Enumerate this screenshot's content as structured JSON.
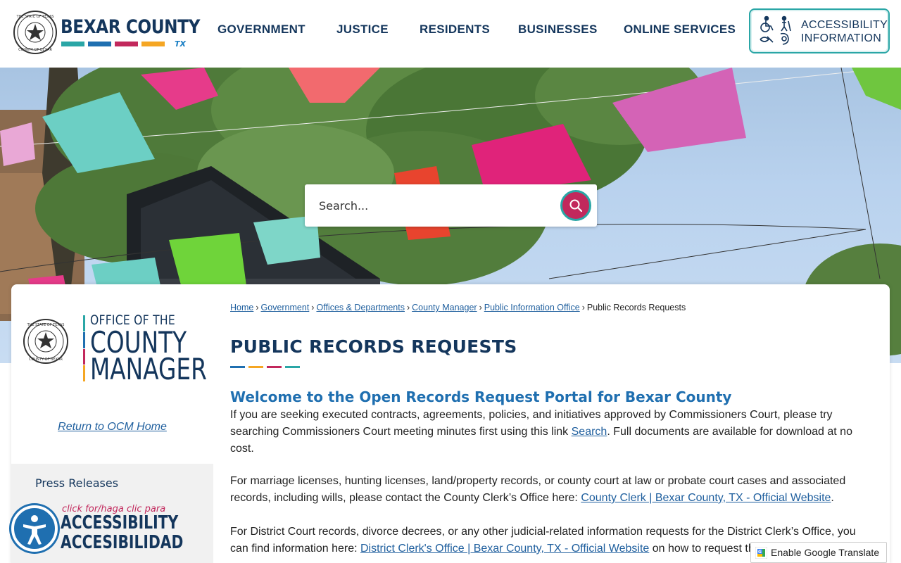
{
  "header": {
    "logo_title": "BEXAR COUNTY",
    "logo_tx": "TX",
    "nav": [
      {
        "label": "GOVERNMENT"
      },
      {
        "label": "JUSTICE"
      },
      {
        "label": "RESIDENTS"
      },
      {
        "label": "BUSINESSES"
      },
      {
        "label": "ONLINE SERVICES"
      }
    ],
    "accessibility": {
      "line1": "ACCESSIBILITY",
      "line2": "INFORMATION"
    }
  },
  "search": {
    "placeholder": "Search..."
  },
  "sidebar": {
    "ocm_line1": "OFFICE OF THE",
    "ocm_line2": "COUNTY",
    "ocm_line3": "MANAGER",
    "return_link": "Return to OCM Home",
    "nav_items": [
      "Press Releases"
    ]
  },
  "breadcrumb": {
    "items": [
      "Home",
      "Government",
      "Offices & Departments",
      "County Manager",
      "Public Information Office"
    ],
    "current": "Public Records Requests",
    "separator": "›"
  },
  "main": {
    "title": "PUBLIC RECORDS REQUESTS",
    "welcome": "Welcome to the Open Records Request Portal for Bexar County",
    "p1_before": "If you are seeking executed contracts, agreements, policies, and initiatives approved by Commissioners Court, please try searching Commissioners Court meeting minutes first using this link ",
    "p1_link": "Search",
    "p1_after": ". Full documents are available for download at no cost.",
    "p2_before": "For marriage licenses, hunting licenses, land/property records, or county court at law or probate court cases and associated records, including wills, please contact the County Clerk’s Office here: ",
    "p2_link": "County Clerk | Bexar County, TX - Official Website",
    "p2_after": ".",
    "p3_before": "For District Court records, divorce decrees, or any other judicial-related information requests for the District Clerk’s Office, you can find information here: ",
    "p3_link": "District Clerk's Office | Bexar County, TX - Official Website",
    "p3_after": " on how to request th"
  },
  "widgets": {
    "a11y_small": "click for/haga clic para",
    "a11y_big1": "ACCESSIBILITY",
    "a11y_big2": "ACCESIBILIDAD",
    "translate": "Enable Google Translate"
  },
  "colors": {
    "navy": "#14365c",
    "teal": "#2aa6a6",
    "blue": "#1f6fb0",
    "magenta": "#c2285c",
    "orange": "#f5a623"
  },
  "icons": [
    "search-icon",
    "accessibility-icons",
    "accessibility-person-icon",
    "google-g-icon"
  ]
}
